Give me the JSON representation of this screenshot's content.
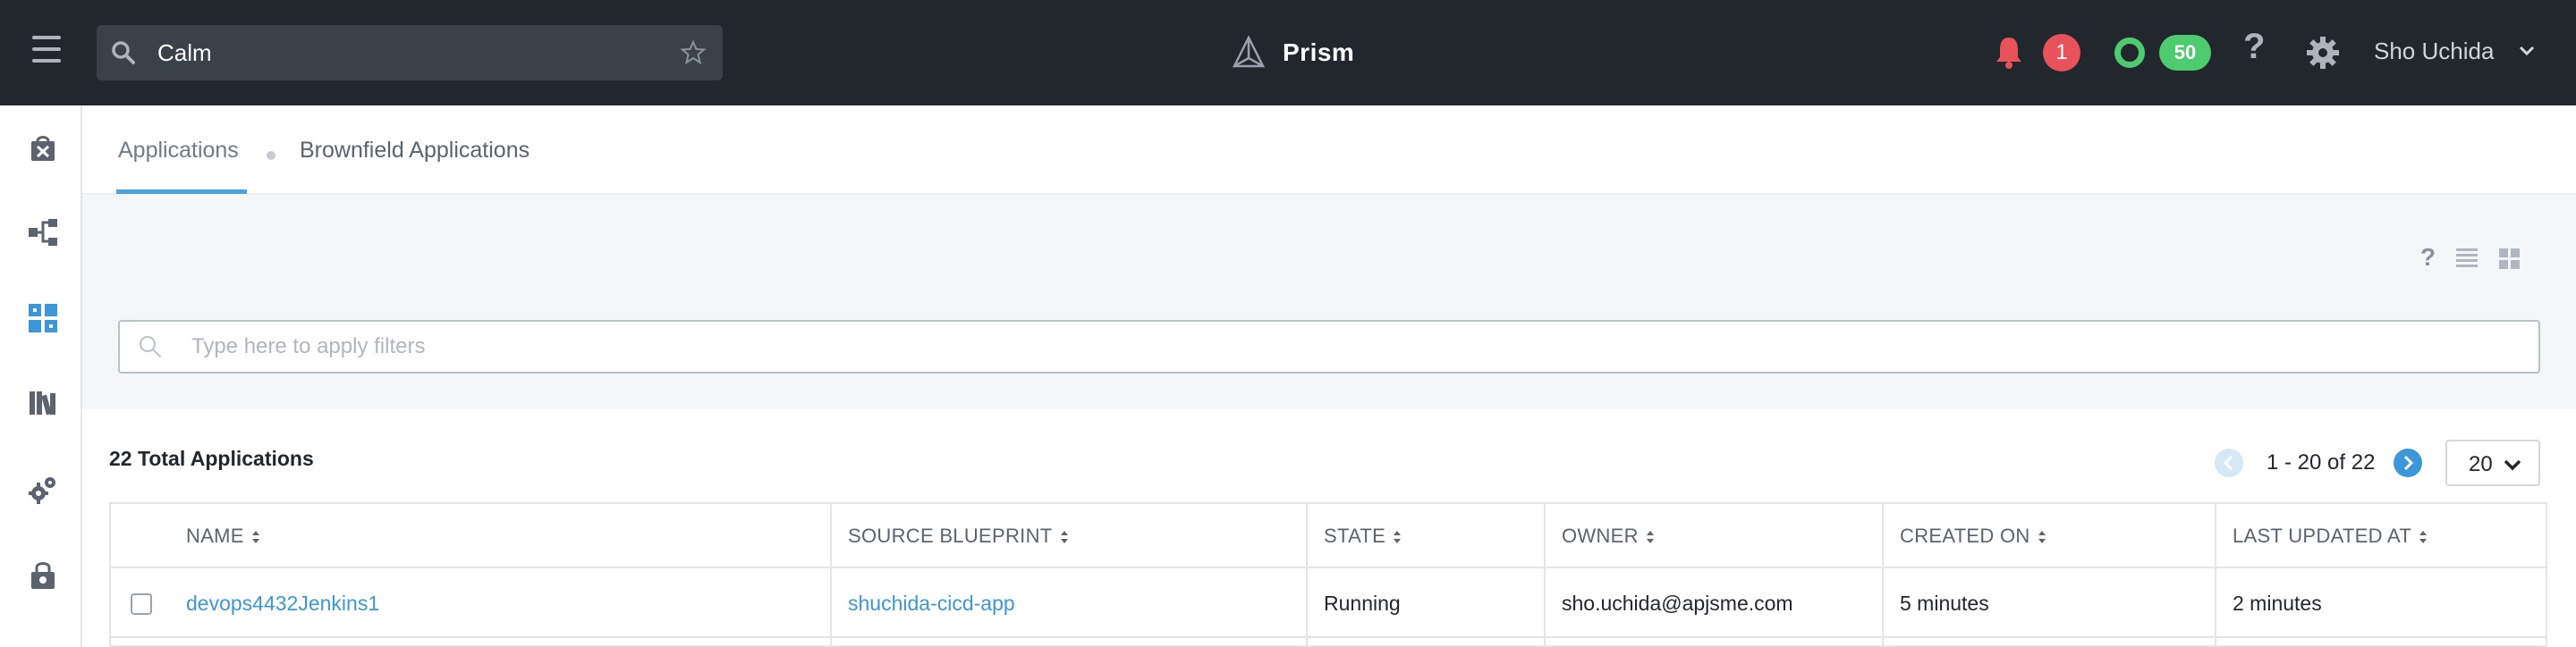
{
  "topbar": {
    "search_value": "Calm",
    "brand_name": "Prism",
    "alerts_count": "1",
    "health_count": "50",
    "help_label": "?",
    "user_name": "Sho Uchida"
  },
  "icons": {
    "menu": "hamburger-icon",
    "search": "search-icon",
    "favorite": "star-icon",
    "logo": "prism-logo-icon",
    "alerts": "bell-icon",
    "health": "health-ring-icon",
    "settings": "gear-icon",
    "user_menu": "chevron-down-icon"
  },
  "leftnav": {
    "items": [
      {
        "icon": "marketplace-bag-icon",
        "active": false
      },
      {
        "icon": "blueprints-icon",
        "active": false
      },
      {
        "icon": "applications-icon",
        "active": true
      },
      {
        "icon": "library-icon",
        "active": false
      },
      {
        "icon": "settings-gears-icon",
        "active": false
      },
      {
        "icon": "policies-lock-icon",
        "active": false
      }
    ]
  },
  "tabs": [
    {
      "label": "Applications",
      "active": true
    },
    {
      "label": "Brownfield Applications",
      "active": false
    }
  ],
  "toolbar": {
    "help_label": "?",
    "list_view": "list-view-icon",
    "grid_view": "grid-view-icon"
  },
  "filter": {
    "placeholder": "Type here to apply filters"
  },
  "summary": {
    "total_label": "22 Total Applications"
  },
  "pagination": {
    "range_text": "1 - 20 of 22",
    "per_page": "20"
  },
  "table": {
    "columns": [
      "NAME",
      "SOURCE BLUEPRINT",
      "STATE",
      "OWNER",
      "CREATED ON",
      "LAST UPDATED AT"
    ],
    "rows": [
      {
        "name": "devops4432Jenkins1",
        "source_blueprint": "shuchida-cicd-app",
        "state": "Running",
        "owner": "sho.uchida@apjsme.com",
        "created_on": "5 minutes",
        "last_updated_at": "2 minutes"
      }
    ]
  },
  "colors": {
    "topbar_bg": "#22272e",
    "accent_blue": "#3c97d8",
    "alert_red": "#e8525a",
    "health_green": "#4ecb6f"
  }
}
